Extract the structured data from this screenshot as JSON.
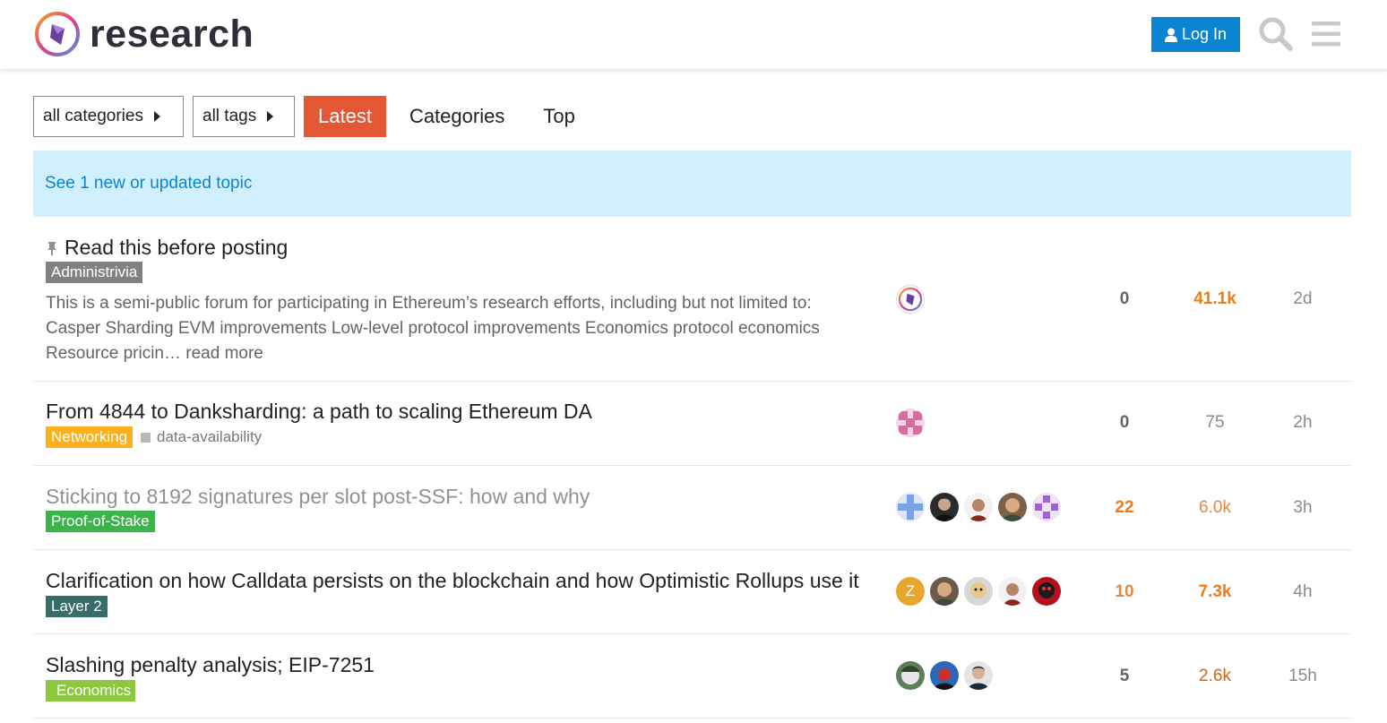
{
  "header": {
    "site_name": "research",
    "login_label": "Log In"
  },
  "nav": {
    "categories_dropdown": "all categories",
    "tags_dropdown": "all tags",
    "tabs": [
      {
        "label": "Latest",
        "active": true
      },
      {
        "label": "Categories"
      },
      {
        "label": "Top"
      }
    ]
  },
  "banner": {
    "text": "See 1 new or updated topic"
  },
  "colors": {
    "accent": "#e45735",
    "login_blue": "#0a84d0",
    "banner_bg": "#d1f0ff",
    "administrivia": "#808281",
    "networking": "#fbb117",
    "proof_of_stake": "#3ab54a",
    "layer2": "#3a6b6b",
    "economics": "#8dc63f"
  },
  "topics": [
    {
      "title": "Read this before posting",
      "pinned": true,
      "category": "Administrivia",
      "excerpt": "This is a semi-public forum for participating in Ethereum’s research efforts, including but not limited to: Casper Sharding EVM improvements Low-level protocol improvements Economics protocol economics Resource pricin…",
      "read_more": "read more",
      "replies": "0",
      "views": "41.1k",
      "activity": "2d",
      "posters": [
        "logo-avatar"
      ]
    },
    {
      "title": "From 4844 to Danksharding: a path to scaling Ethereum DA",
      "category": "Networking",
      "tag": "data-availability",
      "replies": "0",
      "views": "75",
      "activity": "2h",
      "posters": [
        "pink-pattern-avatar"
      ]
    },
    {
      "title": "Sticking to 8192 signatures per slot post-SSF: how and why",
      "category": "Proof-of-Stake",
      "replies": "22",
      "views": "6.0k",
      "activity": "3h",
      "posters": [
        "blue-pattern-avatar",
        "user-photo-avatar",
        "user-photo-avatar",
        "user-photo-avatar",
        "purple-pattern-avatar"
      ]
    },
    {
      "title": "Clarification on how Calldata persists on the blockchain and how Optimistic Rollups use it",
      "category": "Layer 2",
      "replies": "10",
      "views": "7.3k",
      "activity": "4h",
      "posters": [
        "letter-avatar",
        "user-photo-avatar",
        "user-photo-avatar",
        "user-photo-avatar",
        "user-photo-avatar"
      ],
      "letter": "Z"
    },
    {
      "title": "Slashing penalty analysis; EIP-7251",
      "category": "Economics",
      "replies": "5",
      "views": "2.6k",
      "activity": "15h",
      "posters": [
        "user-photo-avatar",
        "user-photo-avatar",
        "user-photo-avatar"
      ]
    }
  ]
}
